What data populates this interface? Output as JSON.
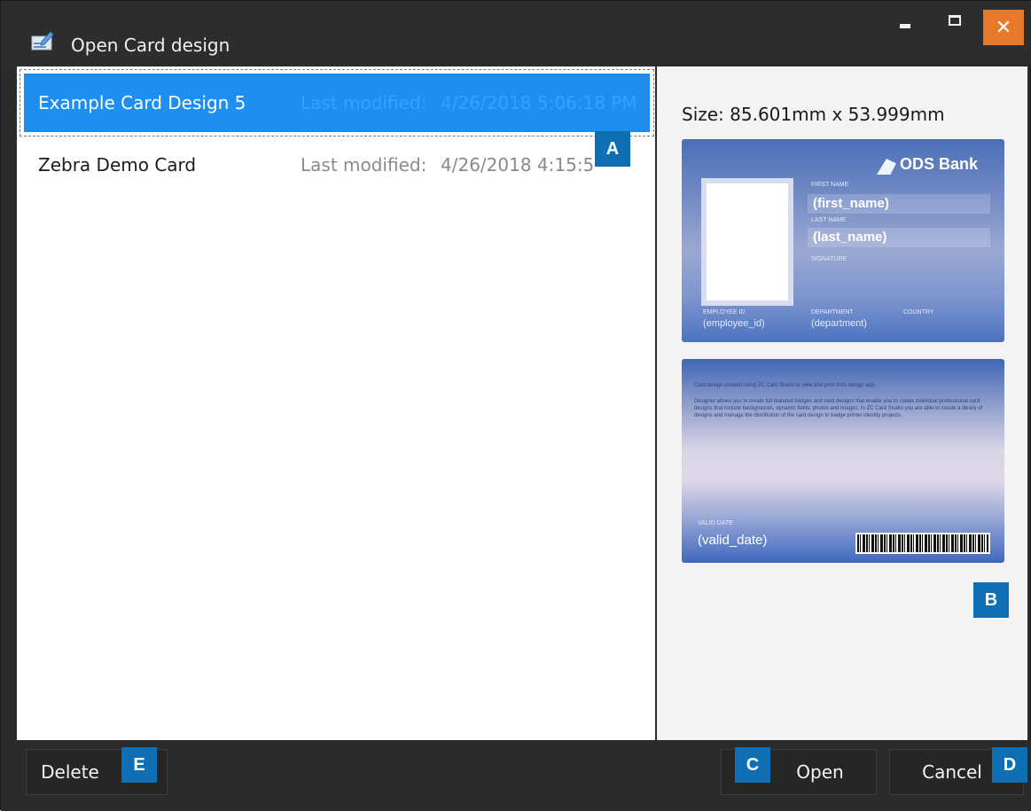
{
  "window": {
    "title": "Open Card design",
    "controls": {
      "minimize": "minimize-icon",
      "maximize": "maximize-icon",
      "close": "close-icon"
    },
    "close_color": "#e9792a"
  },
  "list": {
    "items": [
      {
        "name": "Example Card Design 5",
        "modified_label": "Last modified:",
        "modified_value": "4/26/2018 5:06:18 PM",
        "selected": true
      },
      {
        "name": "Zebra Demo Card",
        "modified_label": "Last modified:",
        "modified_value": "4/26/2018 4:15:5",
        "selected": false
      }
    ],
    "selection_color": "#1e8ff0"
  },
  "preview": {
    "size_text": "Size: 85.601mm x 53.999mm",
    "front": {
      "bank_name": "ODS Bank",
      "first_name_label": "FIRST NAME",
      "first_name": "(first_name)",
      "last_name_label": "LAST NAME",
      "last_name": "(last_name)",
      "signature_label": "SIGNATURE",
      "employee_id_label": "EMPLOYEE ID",
      "employee_id": "(employee_id)",
      "department_label": "DEPARTMENT",
      "department": "(department)",
      "country_label": "COUNTRY"
    },
    "back": {
      "text_line_1": "Card design created using ZC Card Studio to view and print from design app.",
      "text_block": "Designer allows you to create full featured badges and card designs that enable you to create individual professional card designs that include backgrounds, dynamic fields, photos and images. In ZC Card Studio you are able to create a library of designs and manage the distribution of the card design to badge printer identity projects.",
      "valid_label": "VALID DATE",
      "valid_value": "(valid_date)"
    }
  },
  "callouts": {
    "a": "A",
    "b": "B",
    "c": "C",
    "d": "D",
    "e": "E"
  },
  "callout_color": "#0e6fb4",
  "buttons": {
    "delete": "Delete",
    "open": "Open",
    "cancel": "Cancel"
  }
}
